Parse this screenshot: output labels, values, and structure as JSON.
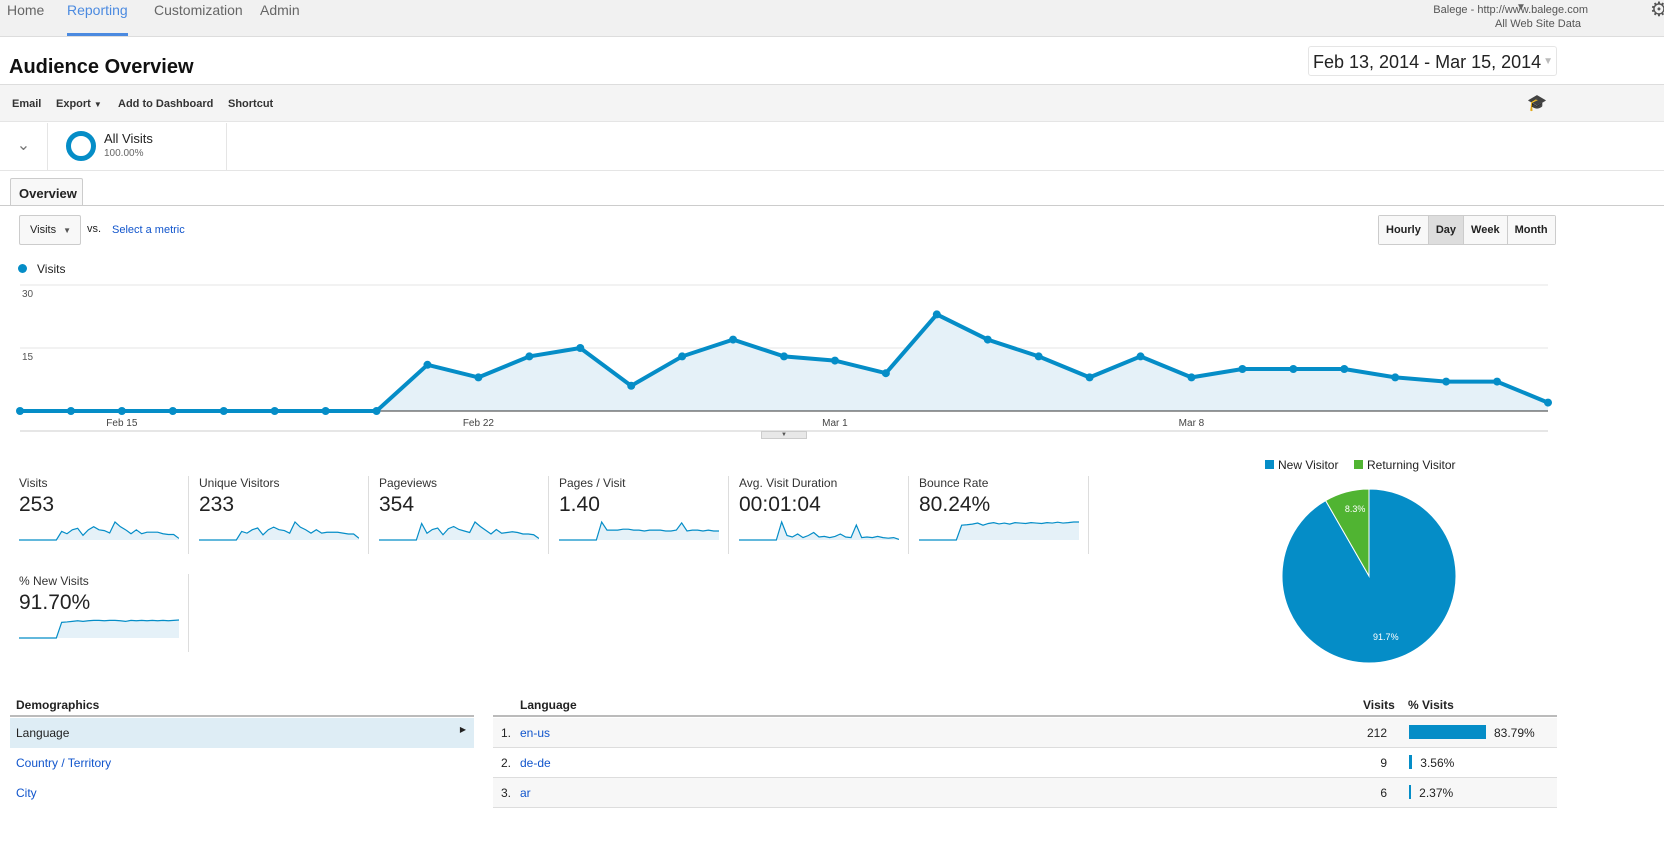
{
  "nav": {
    "items": [
      "Home",
      "Reporting",
      "Customization",
      "Admin"
    ],
    "active": "Reporting"
  },
  "account": {
    "name": "Balege - http://www.balege.com",
    "view": "All Web Site Data"
  },
  "page": {
    "title": "Audience Overview",
    "date_range": "Feb 13, 2014 - Mar 15, 2014"
  },
  "toolbar": {
    "email": "Email",
    "export": "Export",
    "add_to_dashboard": "Add to Dashboard",
    "shortcut": "Shortcut"
  },
  "segment": {
    "name": "All Visits",
    "percent": "100.00%"
  },
  "tabs": {
    "overview": "Overview"
  },
  "chart_controls": {
    "metric": "Visits",
    "vs": "vs.",
    "select_metric": "Select a metric",
    "granularity": [
      "Hourly",
      "Day",
      "Week",
      "Month"
    ],
    "selected": "Day"
  },
  "colors": {
    "accent": "#058dc7",
    "returning": "#50b432",
    "fill": "#e5f1f8"
  },
  "chart_data": [
    {
      "type": "line",
      "series": [
        {
          "name": "Visits",
          "values": [
            0,
            0,
            0,
            0,
            0,
            0,
            0,
            0,
            11,
            8,
            13,
            15,
            6,
            13,
            17,
            13,
            12,
            9,
            23,
            17,
            13,
            8,
            13,
            8,
            10,
            10,
            10,
            8,
            7,
            7,
            2
          ]
        }
      ],
      "x_start": "Feb 13, 2014",
      "x_end": "Mar 15, 2014",
      "x_tick_labels": [
        "Feb 15",
        "Feb 22",
        "Mar 1",
        "Mar 8"
      ],
      "y_tick_labels": [
        "30",
        "15"
      ],
      "ylim": [
        0,
        30
      ],
      "grid": true,
      "legend": "top-left"
    },
    {
      "type": "pie",
      "legend": "top",
      "slices": [
        {
          "name": "New Visitor",
          "value": 91.7,
          "label": "91.7%"
        },
        {
          "name": "Returning Visitor",
          "value": 8.3,
          "label": "8.3%"
        }
      ]
    }
  ],
  "metrics": [
    {
      "label": "Visits",
      "value": "253",
      "spark": [
        0,
        0,
        0,
        0,
        0,
        0,
        0,
        0,
        11,
        8,
        13,
        15,
        6,
        13,
        17,
        13,
        12,
        9,
        23,
        17,
        13,
        8,
        13,
        8,
        10,
        10,
        10,
        8,
        7,
        7,
        2
      ]
    },
    {
      "label": "Unique Visitors",
      "value": "233",
      "spark": [
        0,
        0,
        0,
        0,
        0,
        0,
        0,
        0,
        10,
        8,
        12,
        14,
        6,
        12,
        15,
        12,
        11,
        8,
        21,
        15,
        12,
        8,
        12,
        8,
        9,
        9,
        9,
        8,
        7,
        7,
        2
      ]
    },
    {
      "label": "Pageviews",
      "value": "354",
      "spark": [
        0,
        0,
        0,
        0,
        0,
        0,
        0,
        0,
        22,
        9,
        14,
        16,
        7,
        15,
        18,
        14,
        12,
        10,
        24,
        18,
        13,
        8,
        14,
        9,
        10,
        11,
        10,
        8,
        8,
        7,
        2
      ]
    },
    {
      "label": "Pages / Visit",
      "value": "1.40",
      "spark": [
        0,
        0,
        0,
        0,
        0,
        0,
        0,
        0,
        2,
        1.1,
        1.1,
        1.1,
        1.2,
        1.2,
        1.1,
        1.1,
        1,
        1.1,
        1.1,
        1.1,
        1,
        1,
        1.1,
        1.9,
        1,
        1.1,
        1.1,
        1,
        1.1,
        1,
        1
      ]
    },
    {
      "label": "Avg. Visit Duration",
      "value": "00:01:04",
      "spark": [
        0,
        0,
        0,
        0,
        0,
        0,
        0,
        0,
        60,
        15,
        10,
        20,
        8,
        15,
        25,
        10,
        12,
        8,
        12,
        20,
        10,
        8,
        50,
        8,
        10,
        8,
        12,
        8,
        6,
        8,
        2
      ]
    },
    {
      "label": "Bounce Rate",
      "value": "80.24%",
      "spark": [
        0,
        0,
        0,
        0,
        0,
        0,
        0,
        0,
        70,
        72,
        75,
        80,
        70,
        78,
        82,
        76,
        80,
        75,
        82,
        80,
        78,
        82,
        80,
        78,
        82,
        80,
        84,
        80,
        82,
        85,
        85
      ]
    },
    {
      "label": "% New Visits",
      "value": "91.70%",
      "spark": [
        0,
        0,
        0,
        0,
        0,
        0,
        0,
        0,
        80,
        82,
        85,
        88,
        85,
        88,
        90,
        90,
        88,
        90,
        90,
        88,
        85,
        90,
        88,
        90,
        88,
        90,
        88,
        90,
        88,
        90,
        92
      ]
    }
  ],
  "demographics": {
    "heading": "Demographics",
    "items": [
      "Language",
      "Country / Territory",
      "City"
    ],
    "selected": "Language"
  },
  "language_table": {
    "columns": [
      "Language",
      "Visits",
      "% Visits"
    ],
    "rows": [
      {
        "rank": "1.",
        "name": "en-us",
        "visits": "212",
        "pct": "83.79%",
        "pct_value": 83.79
      },
      {
        "rank": "2.",
        "name": "de-de",
        "visits": "9",
        "pct": "3.56%",
        "pct_value": 3.56
      },
      {
        "rank": "3.",
        "name": "ar",
        "visits": "6",
        "pct": "2.37%",
        "pct_value": 2.37
      }
    ]
  }
}
